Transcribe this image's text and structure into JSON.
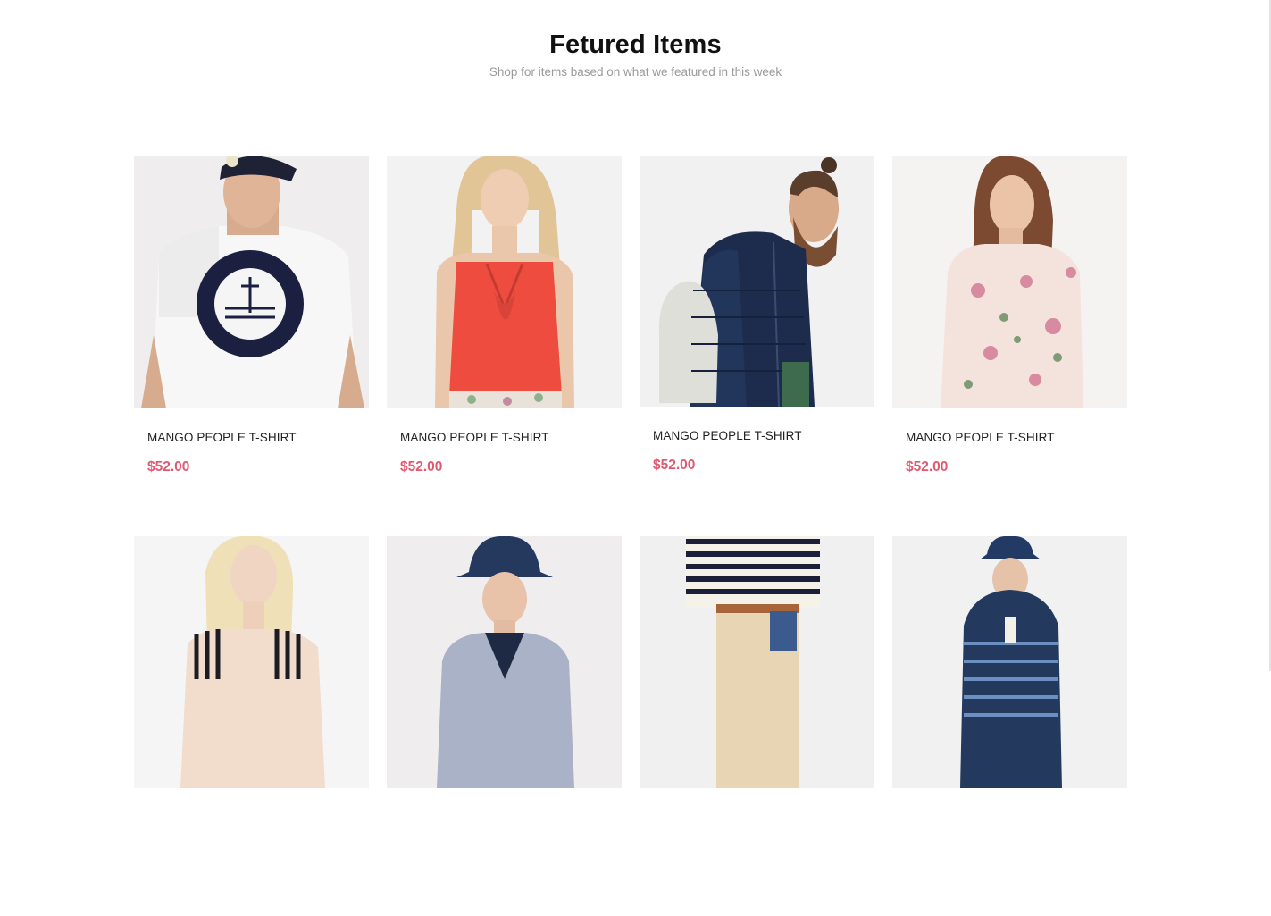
{
  "section": {
    "title": "Fetured Items",
    "subtitle": "Shop for items based on what we featured in this week"
  },
  "colors": {
    "price": "#e4586f",
    "background": "#ffffff",
    "title": "#111111",
    "subtitle": "#9a9a9a"
  },
  "products": [
    {
      "name": "MANGO PEOPLE T-SHIRT",
      "price": "$52.00",
      "image": "man-white-tshirt-photo"
    },
    {
      "name": "MANGO PEOPLE T-SHIRT",
      "price": "$52.00",
      "image": "woman-red-blouse-photo"
    },
    {
      "name": "MANGO PEOPLE T-SHIRT",
      "price": "$52.00",
      "image": "man-navy-jacket-photo"
    },
    {
      "name": "MANGO PEOPLE T-SHIRT",
      "price": "$52.00",
      "image": "woman-floral-dress-photo"
    },
    {
      "name": "",
      "price": "",
      "image": "woman-striped-top-photo"
    },
    {
      "name": "",
      "price": "",
      "image": "man-grey-blazer-photo"
    },
    {
      "name": "",
      "price": "",
      "image": "man-striped-sweater-photo"
    },
    {
      "name": "",
      "price": "",
      "image": "man-striped-poncho-photo"
    }
  ]
}
